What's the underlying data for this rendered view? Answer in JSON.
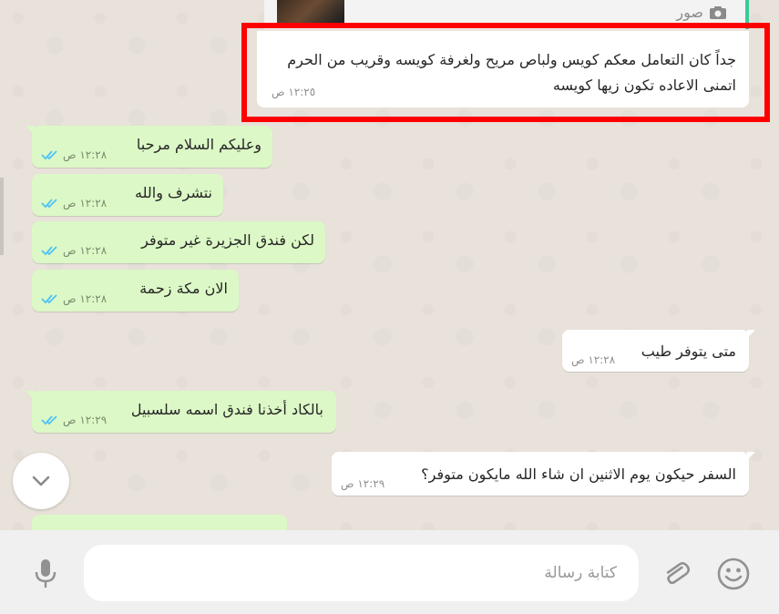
{
  "top_message": {
    "media_label": "صور",
    "line1": "جداً كان التعامل معكم كويس ولباص مريح ولغرفة كويسه وقريب من الحرم",
    "line2": "اتمنى الاعاده تكون زيها كويسه",
    "time": "١٢:٢٥ ص"
  },
  "messages": [
    {
      "text": "وعليكم السلام مرحبا",
      "time": "١٢:٢٨ ص"
    },
    {
      "text": "نتشرف والله",
      "time": "١٢:٢٨ ص"
    },
    {
      "text": "لكن فندق الجزيرة غير متوفر",
      "time": "١٢:٢٨ ص"
    },
    {
      "text": "الان مكة زحمة",
      "time": "١٢:٢٨ ص"
    },
    {
      "text": "متى يتوفر طيب",
      "time": "١٢:٢٨ ص"
    },
    {
      "text": "بالكاد أخذنا فندق اسمه سلسبيل",
      "time": "١٢:٢٩ ص"
    },
    {
      "text": "السفر حيكون يوم الاثنين ان شاء الله مايكون متوفر؟",
      "time": "١٢:٢٩ ص"
    }
  ],
  "composer": {
    "placeholder": "كتابة رسالة"
  },
  "colors": {
    "outgoing_bubble": "#dcf8c6",
    "incoming_bubble": "#ffffff",
    "read_ticks": "#4fc3f7",
    "highlight": "#ff0000"
  },
  "icons": [
    "camera-icon",
    "double-check-icon",
    "chevron-down-icon",
    "mic-icon",
    "paperclip-icon",
    "emoji-icon"
  ]
}
